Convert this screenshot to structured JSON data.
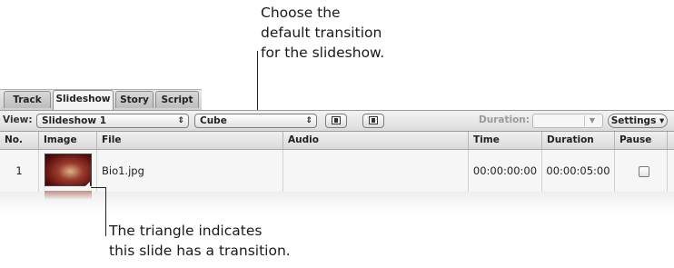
{
  "callouts": {
    "top": [
      "Choose the",
      "default transition",
      "for the slideshow."
    ],
    "bottom": [
      "The triangle indicates",
      "this slide has a transition."
    ]
  },
  "tabs": [
    {
      "label": "Track",
      "active": false
    },
    {
      "label": "Slideshow",
      "active": true
    },
    {
      "label": "Story",
      "active": false
    },
    {
      "label": "Script",
      "active": false
    }
  ],
  "toolbar": {
    "view_label": "View:",
    "view_value": "Slideshow 1",
    "transition_value": "Cube",
    "duration_label": "Duration:",
    "duration_value": "",
    "settings_label": "Settings ▾"
  },
  "table": {
    "columns": [
      "No.",
      "Image",
      "File",
      "Audio",
      "Time",
      "Duration",
      "Pause"
    ],
    "rows": [
      {
        "no": "1",
        "file": "Bio1.jpg",
        "audio": "",
        "time": "00:00:00:00",
        "duration": "00:00:05:00",
        "pause": false
      }
    ]
  },
  "icons": {
    "popup_arrows": "updown-arrows-icon",
    "thumbnail": "slide-thumbnail",
    "transition_marker": "transition-triangle-icon",
    "duration_arrow": "chevron-down-icon"
  }
}
